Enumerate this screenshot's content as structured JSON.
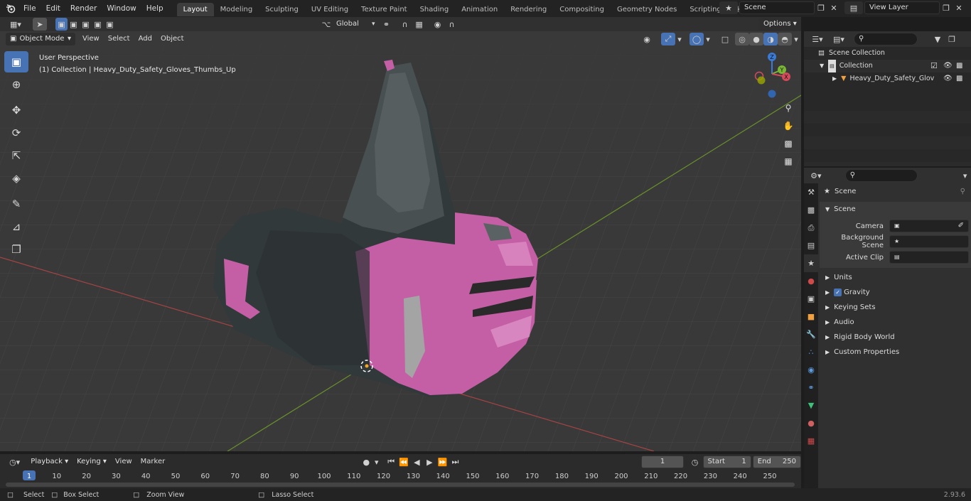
{
  "topbar": {
    "menus": [
      "File",
      "Edit",
      "Render",
      "Window",
      "Help"
    ],
    "workspaces": [
      "Layout",
      "Modeling",
      "Sculpting",
      "UV Editing",
      "Texture Paint",
      "Shading",
      "Animation",
      "Rendering",
      "Compositing",
      "Geometry Nodes",
      "Scripting"
    ],
    "active_workspace": "Layout",
    "add_tab": "+",
    "scene": "Scene",
    "view_layer": "View Layer"
  },
  "viewport": {
    "mode": "Object Mode",
    "menus": [
      "View",
      "Select",
      "Add",
      "Object"
    ],
    "transform_orientation": "Global",
    "options_label": "Options",
    "perspective": "User Perspective",
    "collection_info": "(1) Collection | Heavy_Duty_Safety_Gloves_Thumbs_Up",
    "gizmo_axes": [
      "X",
      "Y",
      "Z"
    ]
  },
  "outliner": {
    "search_placeholder": "",
    "scene_collection": "Scene Collection",
    "collection": "Collection",
    "object": "Heavy_Duty_Safety_Glov"
  },
  "properties": {
    "context": "Scene",
    "section": "Scene",
    "fields": [
      {
        "label": "Camera",
        "value": ""
      },
      {
        "label": "Background Scene",
        "value": ""
      },
      {
        "label": "Active Clip",
        "value": ""
      }
    ],
    "panels": [
      "Units",
      "Gravity",
      "Keying Sets",
      "Audio",
      "Rigid Body World",
      "Custom Properties"
    ],
    "gravity_checked": true
  },
  "timeline": {
    "menus": [
      "Playback",
      "Keying",
      "View",
      "Marker"
    ],
    "current_frame": "1",
    "start_label": "Start",
    "start": "1",
    "end_label": "End",
    "end": "250",
    "ruler": [
      "1",
      "10",
      "20",
      "30",
      "40",
      "50",
      "60",
      "70",
      "80",
      "90",
      "100",
      "110",
      "120",
      "130",
      "140",
      "150",
      "160",
      "170",
      "180",
      "190",
      "200",
      "210",
      "220",
      "230",
      "240",
      "250"
    ]
  },
  "statusbar": {
    "items": [
      "Select",
      "Box Select",
      "Zoom View",
      "Lasso Select"
    ],
    "version": "2.93.6"
  },
  "colors": {
    "accent": "#4772b3",
    "glove_pink": "#c45fa6",
    "glove_dark": "#3a4245",
    "axis_x": "#b84a4a",
    "axis_y": "#6a9a2a"
  }
}
